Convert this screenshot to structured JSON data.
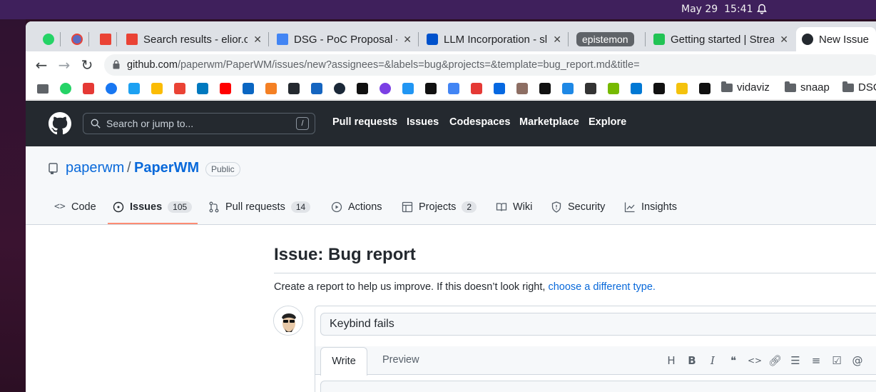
{
  "system": {
    "date": "May 29",
    "time": "15:41"
  },
  "tabs": [
    {
      "title": "",
      "icon": "whatsapp-icon",
      "color": "#25d366"
    },
    {
      "title": "",
      "icon": "gmail-badge-icon",
      "color": "#ea4335"
    },
    {
      "title": "",
      "icon": "gmail-icon",
      "color": "#ea4335"
    },
    {
      "title": "Search results - elior.c",
      "icon": "gmail-icon",
      "color": "#ea4335"
    },
    {
      "title": "DSG - PoC Proposal - I",
      "icon": "google-docs-icon",
      "color": "#4285f4"
    },
    {
      "title": "LLM Incorporation - sl",
      "icon": "confluence-icon",
      "color": "#0052cc"
    },
    {
      "title": "epistemon",
      "icon": "tab-group-label",
      "color": "#5f6368"
    },
    {
      "title": "Getting started | Strea",
      "icon": "streamlit-icon",
      "color": "#21c354"
    },
    {
      "title": "New Issue -",
      "icon": "github-icon",
      "color": "#24292f"
    }
  ],
  "address_bar": {
    "host": "github.com",
    "path": "/paperwm/PaperWM/issues/new?assignees=&labels=bug&projects=&template=bug_report.md&title="
  },
  "bookmarks": {
    "icons": [
      "folder",
      "whatsapp",
      "red-diamond",
      "facebook",
      "twitter",
      "google-drive",
      "gmail",
      "trello",
      "youtube",
      "linkedin",
      "stackoverflow",
      "github",
      "klarna",
      "steam",
      "notion",
      "onion",
      "webflow",
      "squarespace",
      "google",
      "chart",
      "meta",
      "photo",
      "vice",
      "ai2",
      "cat",
      "nvidia",
      "azure",
      "openai",
      "python",
      "info"
    ],
    "colors": [
      "#5f6368",
      "#25d366",
      "#e53935",
      "#1877f2",
      "#1da1f2",
      "#fbbc04",
      "#ea4335",
      "#0079bf",
      "#ff0000",
      "#0a66c2",
      "#f48024",
      "#24292f",
      "#1565c0",
      "#1b2838",
      "#111111",
      "#7b3fe4",
      "#2196f3",
      "#111111",
      "#4285f4",
      "#e53935",
      "#0668e1",
      "#8d6e63",
      "#111111",
      "#1e88e5",
      "#333333",
      "#76b900",
      "#0078d4",
      "#111111",
      "#f4c20d",
      "#111111"
    ],
    "folders": [
      "vidaviz",
      "snaap",
      "DSG"
    ]
  },
  "github": {
    "search_placeholder": "Search or jump to...",
    "search_shortcut": "/",
    "nav": [
      "Pull requests",
      "Issues",
      "Codespaces",
      "Marketplace",
      "Explore"
    ]
  },
  "repo": {
    "owner": "paperwm",
    "separator": "/",
    "name": "PaperWM",
    "visibility": "Public",
    "tabs": [
      {
        "label": "Code",
        "count": ""
      },
      {
        "label": "Issues",
        "count": "105"
      },
      {
        "label": "Pull requests",
        "count": "14"
      },
      {
        "label": "Actions",
        "count": ""
      },
      {
        "label": "Projects",
        "count": "2"
      },
      {
        "label": "Wiki",
        "count": ""
      },
      {
        "label": "Security",
        "count": ""
      },
      {
        "label": "Insights",
        "count": ""
      }
    ]
  },
  "issue": {
    "heading": "Issue: Bug report",
    "description": "Create a report to help us improve. If this doesn’t look right,",
    "description_link": "choose a different type.",
    "title_value": "Keybind fails",
    "write_tab": "Write",
    "preview_tab": "Preview",
    "toolbar": [
      "H",
      "B",
      "I",
      "quote",
      "code",
      "link",
      "ul",
      "ol",
      "tasklist",
      "@"
    ]
  }
}
